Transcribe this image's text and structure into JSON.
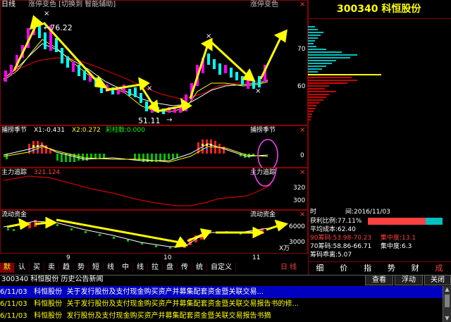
{
  "chart": {
    "mode": "日线",
    "title": "涨停变色 [切换到 智能辅助]",
    "title_right": "涨停变色",
    "high_label": "←76.22",
    "low_label": "51.11",
    "low_arrow": "→",
    "price_ticks": [
      "70",
      "60"
    ],
    "x_ticks": [
      "9",
      "10",
      "11"
    ],
    "period_label": "日线",
    "unit_label": "X万"
  },
  "panes": {
    "p1": {
      "name": "捕捞季节",
      "values": "X1:-0.431  X2:0.272  彩柱数:0.000",
      "x1": "X1:-0.431",
      "x2": "X2:0.272",
      "cz": "彩柱数:0.000",
      "right_name": "捕捞季节",
      "tick": "0"
    },
    "p2": {
      "name": "主力追踪",
      "value": "321.124",
      "right_name": "主力追踪",
      "ticks": [
        "320",
        "300"
      ]
    },
    "p3": {
      "name": "流动资金",
      "right_name": "流动资金",
      "ticks": [
        "6000",
        "3000"
      ]
    }
  },
  "stock": {
    "code_name": "300340 科恒股份",
    "time_label": "时",
    "date_label": "间:2016/11/03",
    "profit_label": "获利比例:77.11%",
    "avg_cost": "平均成本:62.40",
    "chip90": "90筹码:53.98-70.23",
    "concentration90": "集中度:13.1",
    "chip70": "70筹码:58.86-66.71",
    "concentration70": "集中度:6.3",
    "chip_ratio": "筹码乖离:5.07"
  },
  "bottom_tabs": [
    "默",
    "认",
    "买",
    "卖",
    "趋",
    "势",
    "短",
    "线",
    "中",
    "线",
    "拉",
    "盘",
    "传",
    "统",
    "自定义"
  ],
  "period_tab": "日 线",
  "indicator_tabs": [
    "细",
    "价",
    "指",
    "势",
    "财",
    "成"
  ],
  "news": {
    "header": "300340 科恒股份  历史公告新闻",
    "buttons": [
      "查看",
      "浮动",
      "关闭"
    ],
    "rows": [
      {
        "date": "6/11/03",
        "name": "科恒股份",
        "text": "关于发行股份及支付现金购买资产并募集配套资金暨关联交易..."
      },
      {
        "date": "6/11/03",
        "name": "科恒股份",
        "text": "关于发行股份及支付现金购买资产并募集配套资金暨关联交易报告书的修..."
      },
      {
        "date": "6/11/03",
        "name": "科恒股份",
        "text": "发行股份及支付现金购买资产并募集配套资金暨关联交易报告书摘"
      }
    ]
  },
  "colors": {
    "up": "#ff00ff",
    "down": "#00ffff",
    "arrow": "#ffff00",
    "ma_white": "#ffffff",
    "ma_red": "#d00000"
  }
}
